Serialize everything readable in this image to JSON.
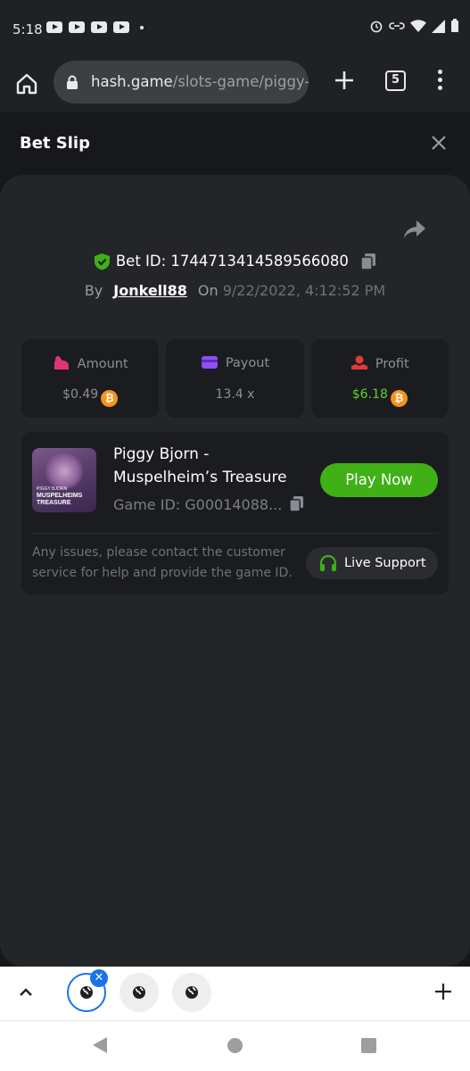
{
  "status_bar": {
    "time": "5:18"
  },
  "browser": {
    "url_host": "hash.game",
    "url_path": "/slots-game/piggy-bj",
    "tab_count": "5"
  },
  "bet_slip": {
    "title": "Bet Slip",
    "bet_id_label": "Bet ID:",
    "bet_id": "1744713414589566080",
    "by_label": "By",
    "username": "Jonkell88",
    "on_label": "On",
    "date": "9/22/2022, 4:12:52 PM",
    "stats": {
      "amount_label": "Amount",
      "amount_value": "$0.49",
      "payout_label": "Payout",
      "payout_value": "13.4 x",
      "profit_label": "Profit",
      "profit_value": "$6.18"
    },
    "game": {
      "thumb_line1": "PIGGY BJORN",
      "thumb_line2": "MUSPELHEIMS TREASURE",
      "name": "Piggy Bjorn - Muspelheim’s Treasure",
      "id_text": "Game ID: G00014088...",
      "play_label": "Play Now"
    },
    "support_text": "Any issues, please contact the customer service for help and provide the game ID.",
    "support_label": "Live Support"
  },
  "colors": {
    "accent_green": "#3fb117",
    "profit_green": "#5fd12a",
    "btc_orange": "#f7931a",
    "tab_blue": "#1a73e8"
  },
  "icons": [
    "home-icon",
    "lock-icon",
    "plus-icon",
    "tab-switcher-icon",
    "more-icon",
    "close-icon",
    "share-icon",
    "shield-check-icon",
    "copy-icon",
    "amount-icon",
    "payout-card-icon",
    "profit-icon",
    "bitcoin-icon",
    "headset-icon",
    "chevron-up-icon",
    "globe-icon"
  ]
}
